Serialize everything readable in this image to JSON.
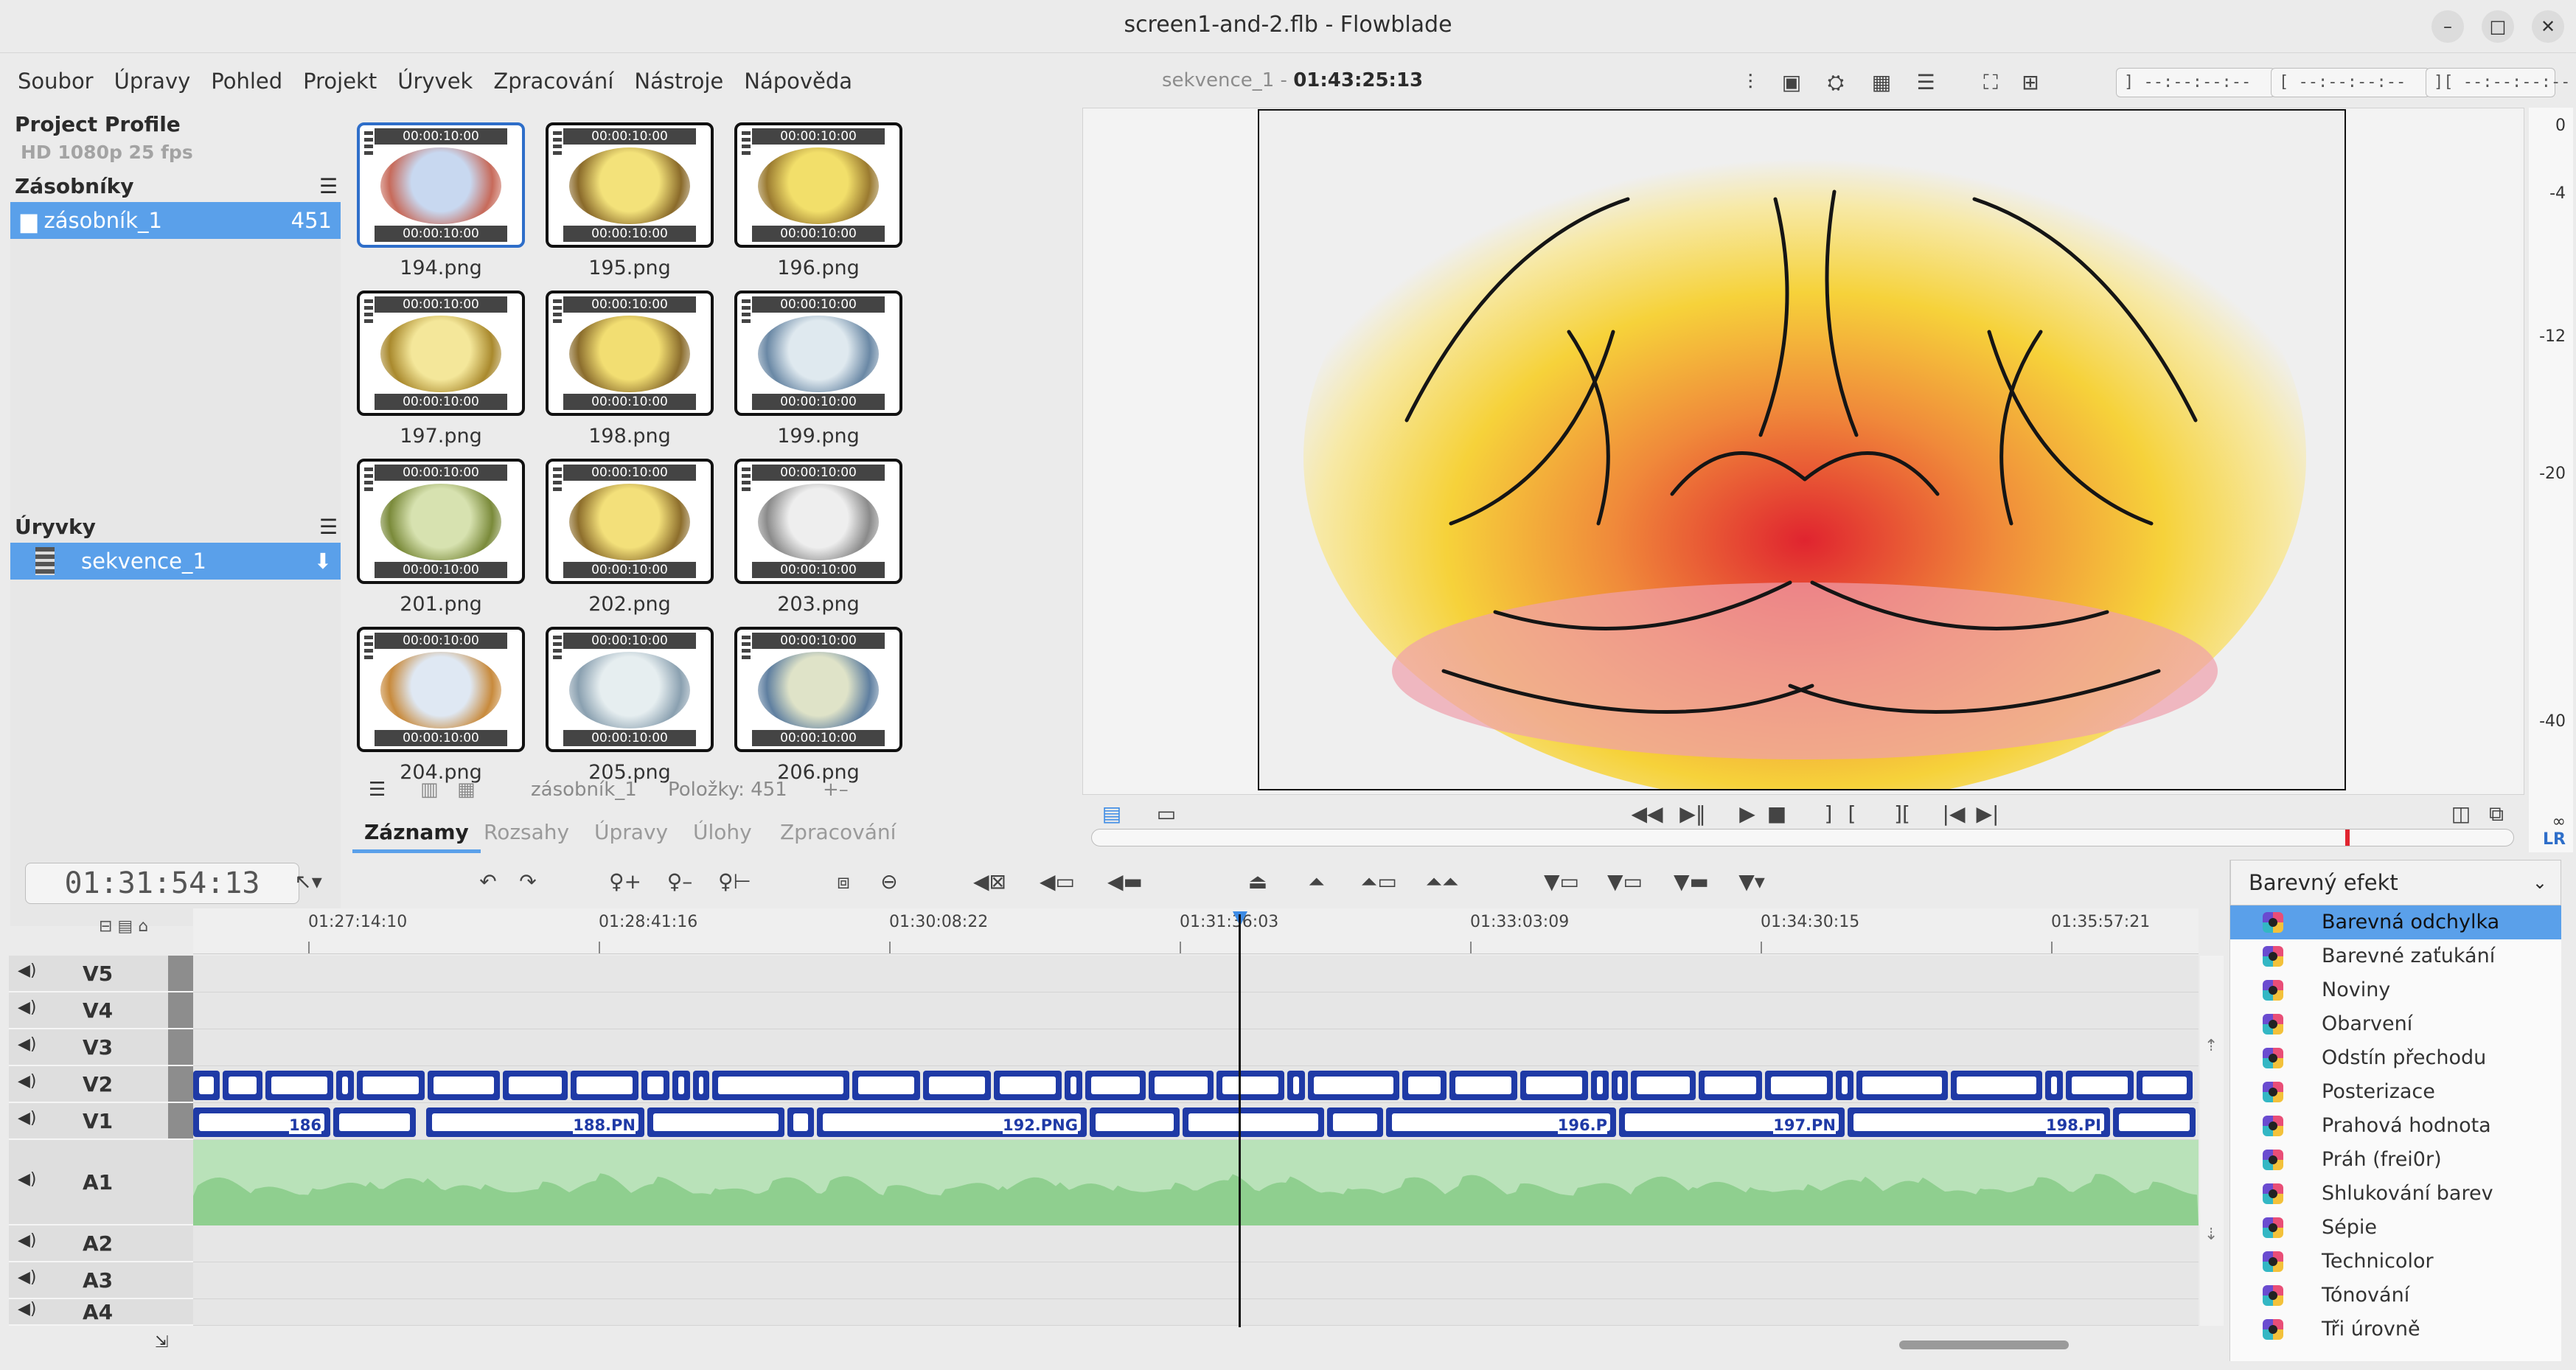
{
  "window": {
    "title": "screen1-and-2.flb - Flowblade",
    "min": "–",
    "max": "□",
    "close": "✕"
  },
  "menu": [
    "Soubor",
    "Úpravy",
    "Pohled",
    "Projekt",
    "Úryvek",
    "Zpracování",
    "Nástroje",
    "Nápověda"
  ],
  "sequence": {
    "name": "sekvence_1",
    "timecode": "01:43:25:13"
  },
  "marks": {
    "in": "] --:--:--:--",
    "out": "[ --:--:--:--",
    "dur": "][ --:--:--:--"
  },
  "project": {
    "label": "Project Profile",
    "profile": "HD 1080p 25 fps"
  },
  "bins": {
    "label": "Zásobníky",
    "items": [
      {
        "name": "zásobník_1",
        "count": "451"
      }
    ]
  },
  "sequences": {
    "label": "Úryvky",
    "items": [
      {
        "name": "sekvence_1"
      }
    ]
  },
  "media": {
    "items": [
      {
        "name": "194.png",
        "tc": "00:00:10:00",
        "selected": true,
        "c1": "#c8d8f0",
        "c2": "#c76a5a"
      },
      {
        "name": "195.png",
        "tc": "00:00:10:00",
        "c1": "#f3e27a",
        "c2": "#8a6a2a"
      },
      {
        "name": "196.png",
        "tc": "00:00:10:00",
        "c1": "#f2df6a",
        "c2": "#9a7a30"
      },
      {
        "name": "197.png",
        "tc": "00:00:10:00",
        "c1": "#f4e79a",
        "c2": "#a9892d"
      },
      {
        "name": "198.png",
        "tc": "00:00:10:00",
        "c1": "#f2de72",
        "c2": "#8b6d2d"
      },
      {
        "name": "199.png",
        "tc": "00:00:10:00",
        "c1": "#dfe9ef",
        "c2": "#6a88a5"
      },
      {
        "name": "201.png",
        "tc": "00:00:10:00",
        "c1": "#d7e2b0",
        "c2": "#7a8a3a"
      },
      {
        "name": "202.png",
        "tc": "00:00:10:00",
        "c1": "#f3e07a",
        "c2": "#8d6e2c"
      },
      {
        "name": "203.png",
        "tc": "00:00:10:00",
        "c1": "#eeeeee",
        "c2": "#8a8a8a"
      },
      {
        "name": "204.png",
        "tc": "00:00:10:00",
        "c1": "#dfe8f3",
        "c2": "#c88a3c"
      },
      {
        "name": "205.png",
        "tc": "00:00:10:00",
        "c1": "#e6eef0",
        "c2": "#8aa0b0"
      },
      {
        "name": "206.png",
        "tc": "00:00:10:00",
        "c1": "#dfe3c8",
        "c2": "#5f7fa0"
      }
    ],
    "binname": "zásobník_1",
    "count": "Položky: 451"
  },
  "tabs": [
    "Záznamy",
    "Rozsahy",
    "Úpravy",
    "Úlohy",
    "Zpracování"
  ],
  "monitor": {
    "scale": [
      "0",
      "-4",
      "-12",
      "-20",
      "-40",
      "∞",
      "LR"
    ]
  },
  "timeline": {
    "timecode": "01:31:54:13",
    "ruler": [
      "01:27:14:10",
      "01:28:41:16",
      "01:30:08:22",
      "01:31:36:03",
      "01:33:03:09",
      "01:34:30:15",
      "01:35:57:21"
    ],
    "tracks": [
      "V5",
      "V4",
      "V3",
      "V2",
      "V1",
      "A1",
      "A2",
      "A3",
      "A4"
    ],
    "clips": [
      "186",
      "188.PN",
      "192.PNG",
      "196.P",
      "197.PN",
      "198.PI"
    ]
  },
  "filters": {
    "group": "Barevný efekt",
    "items": [
      "Barevná odchylka",
      "Barevné zaťukání",
      "Noviny",
      "Obarvení",
      "Odstín přechodu",
      "Posterizace",
      "Prahová hodnota",
      "Práh (frei0r)",
      "Shlukování barev",
      "Sépie",
      "Technicolor",
      "Tónování",
      "Tři úrovně"
    ]
  }
}
